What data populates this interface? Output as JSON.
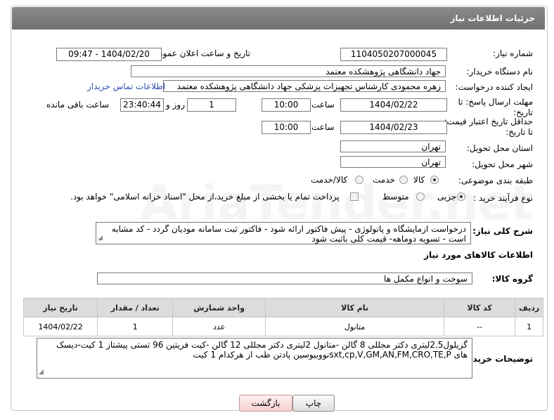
{
  "header": {
    "title": "جزئیات اطلاعات نیاز"
  },
  "fields": {
    "need_number_label": "شماره نیاز:",
    "need_number": "1104050207000045",
    "announce_label": "تاریخ و ساعت اعلان عمومی:",
    "announce_value": "1404/02/20 - 09:47",
    "buyer_org_label": "نام دستگاه خریدار:",
    "buyer_org": "جهاد دانشگاهی پژوهشکده معتمد",
    "requester_label": "ایجاد کننده درخواست:",
    "requester": "زهره محمودی کارشناس تجهیزات پزشکی جهاد دانشگاهی پژوهشکده معتمد",
    "contact_link": "اطلاعات تماس خریدار",
    "reply_deadline_label1": "مهلت ارسال پاسخ: تا",
    "reply_deadline_label2": "تاریخ:",
    "reply_date": "1404/02/22",
    "time_label": "ساعت",
    "reply_time": "10:00",
    "days_value": "1",
    "days_label": "روز و",
    "remaining_value": "23:40:44",
    "remaining_label": "ساعت باقی مانده",
    "price_validity_label1": "حداقل تاریخ اعتبار قیمت:",
    "price_validity_label2": "تا تاریخ:",
    "price_date": "1404/02/23",
    "price_time": "10:00",
    "province_label": "استان محل تحویل:",
    "province": "تهران",
    "city_label": "شهر محل تحویل:",
    "city": "تهران",
    "category_label": "طبقه بندی موضوعی:",
    "category_options": [
      "کالا",
      "خدمت",
      "کالا/خدمت"
    ],
    "process_label": "نوع فرآیند خرید :",
    "process_options": [
      "جزیی",
      "متوسط"
    ],
    "payment_note": "پرداخت تمام یا بخشی از مبلغ خرید،از محل \"اسناد خزانه اسلامی\" خواهد بود.",
    "description_label": "شرح کلی نیاز:",
    "description": "درخواست ازمایشگاه و پاتولوژی - پیش فاکتور ارائه شود - فاکتور ثبت سامانه مودیان گردد - کد مشابه است - تسویه دوماهه- قیمت کلی باثبت شود",
    "goods_info_title": "اطلاعات کالاهای مورد نیاز",
    "goods_group_label": "گروه کالا:",
    "goods_group": "سوخت و انواع مکمل ها",
    "buyer_notes_label": "توضیحات خریدار:",
    "buyer_notes": "گزیلول2.5لیتری دکتر مجللی 8 گالن -متانول 2لیتری دکتر مجللی 12 گالن -کیت فریتین 96 تستی پیشتاز 1 کیت-دیسک های sxt,cp,V,GM,AN,FM,CRO,TE,Pنووبیوسین پادتن طب از هرکدام 1 کیت"
  },
  "table": {
    "headers": [
      "ردیف",
      "کد کالا",
      "نام کالا",
      "واحد شمارش",
      "تعداد / مقدار",
      "تاریخ نیاز"
    ],
    "rows": [
      [
        "1",
        "--",
        "متانول",
        "عدد",
        "1",
        "1404/02/22"
      ]
    ]
  },
  "buttons": {
    "print": "چاپ",
    "back": "بازگشت"
  },
  "watermark": "AriaTender.net"
}
